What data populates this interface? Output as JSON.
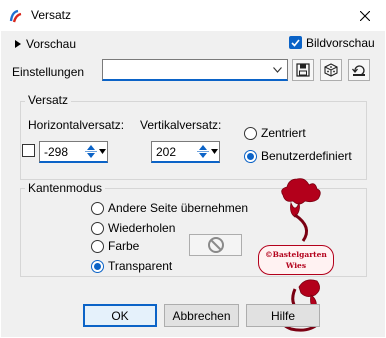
{
  "window": {
    "title": "Versatz"
  },
  "header": {
    "preview_toggle_label": "Vorschau",
    "image_preview_label": "Bildvorschau",
    "image_preview_checked": true
  },
  "settings": {
    "label": "Einstellungen",
    "value": ""
  },
  "offset_group": {
    "title": "Versatz",
    "horizontal_label": "Horizontalversatz:",
    "horizontal_value": "-298",
    "vertical_label": "Vertikalversatz:",
    "vertical_value": "202",
    "link_checked": false,
    "options": [
      {
        "label": "Zentriert",
        "selected": false
      },
      {
        "label": "Benutzerdefiniert",
        "selected": true
      }
    ]
  },
  "edge_group": {
    "title": "Kantenmodus",
    "options": [
      {
        "label": "Andere Seite übernehmen",
        "selected": false
      },
      {
        "label": "Wiederholen",
        "selected": false
      },
      {
        "label": "Farbe",
        "selected": false
      },
      {
        "label": "Transparent",
        "selected": true
      }
    ]
  },
  "watermark": {
    "text": "©Bastelgarten Wies"
  },
  "buttons": {
    "ok": "OK",
    "cancel": "Abbrechen",
    "help": "Hilfe"
  },
  "colors": {
    "accent": "#0b63c7",
    "watermark": "#b3001b"
  }
}
